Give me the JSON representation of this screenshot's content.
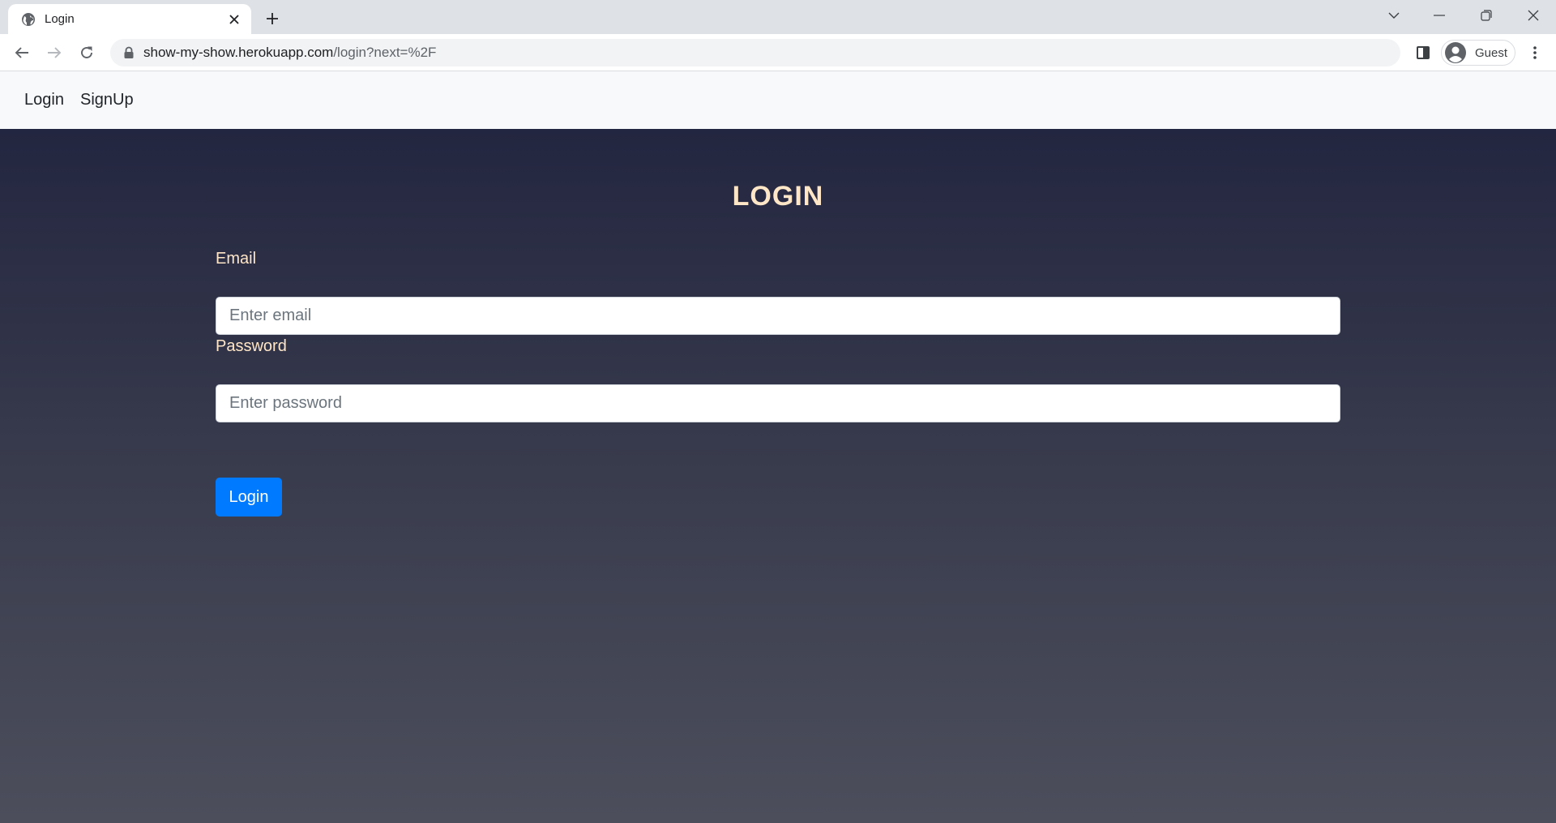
{
  "browser": {
    "tab": {
      "title": "Login"
    },
    "address": {
      "host": "show-my-show.herokuapp.com",
      "path": "/login?next=%2F"
    },
    "profile": {
      "label": "Guest"
    }
  },
  "navbar": {
    "links": [
      {
        "label": "Login"
      },
      {
        "label": "SignUp"
      }
    ]
  },
  "form": {
    "title": "LOGIN",
    "email": {
      "label": "Email",
      "placeholder": "Enter email",
      "value": ""
    },
    "password": {
      "label": "Password",
      "placeholder": "Enter password",
      "value": ""
    },
    "submit_label": "Login"
  },
  "colors": {
    "accent": "#007bff",
    "label": "#ffe6c7",
    "background_top": "#232640",
    "background_bottom": "#4c4e5c",
    "navbar_bg": "#f8f9fa"
  },
  "icons": {
    "tab_favicon": "globe-icon",
    "tab_close": "close-icon",
    "new_tab": "plus-icon",
    "back": "back-arrow-icon",
    "forward": "forward-arrow-icon",
    "reload": "reload-icon",
    "secure": "lock-icon",
    "side_panel": "side-panel-icon",
    "avatar": "avatar-icon",
    "menu": "kebab-menu-icon"
  }
}
